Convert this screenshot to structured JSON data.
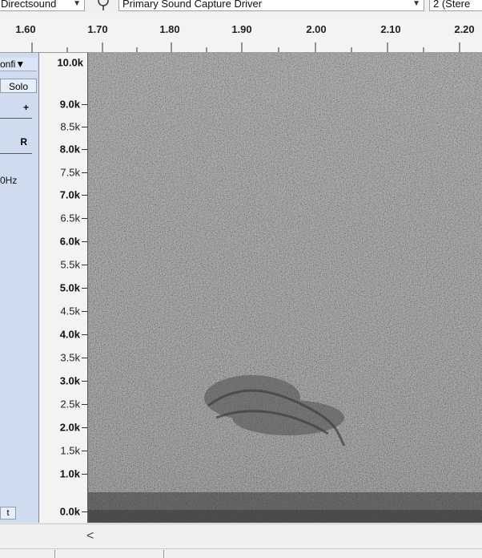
{
  "device_toolbar": {
    "host": "Directsound",
    "recording_device": "Primary Sound Capture Driver",
    "channels": "2 (Stere"
  },
  "ruler": {
    "labels": [
      "1.60",
      "1.70",
      "1.80",
      "1.90",
      "2.00",
      "2.10",
      "2.20"
    ]
  },
  "track_panel": {
    "menu_label": "onfi▼",
    "solo_label": "Solo",
    "gain_plus": "+",
    "pan_right": "R",
    "rate_fragment": "0Hz",
    "bottom_button": "t"
  },
  "freq_axis": {
    "labels": [
      "10.0k",
      "9.0k",
      "8.5k",
      "8.0k",
      "7.5k",
      "7.0k",
      "6.5k",
      "6.0k",
      "5.5k",
      "5.0k",
      "4.5k",
      "4.0k",
      "3.5k",
      "3.0k",
      "2.5k",
      "2.0k",
      "1.5k",
      "1.0k",
      "0.0k"
    ]
  },
  "scrollbar": {
    "left_arrow": "<"
  },
  "colors": {
    "panel_blue": "#cfdcf0",
    "spectrogram_gray": "#7a7a7a"
  }
}
